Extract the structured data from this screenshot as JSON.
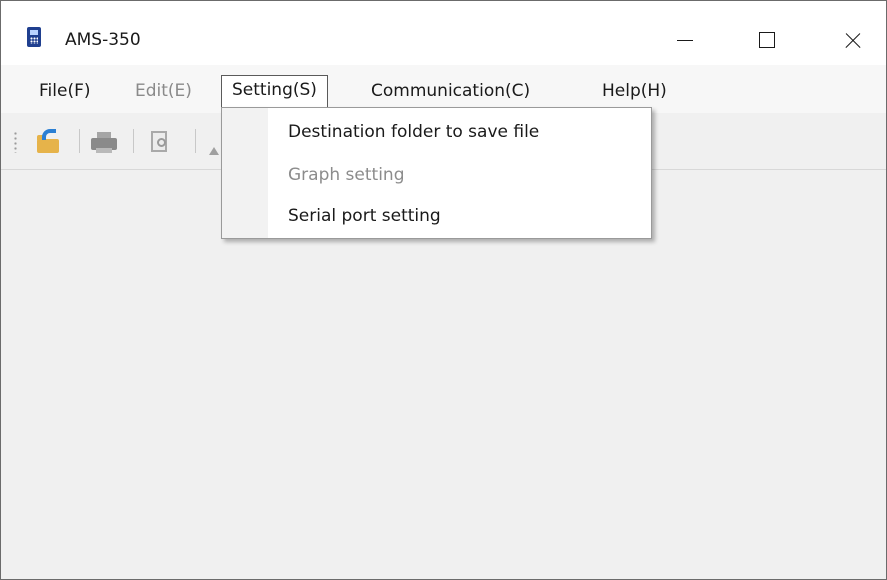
{
  "window": {
    "title": "AMS-350",
    "app_icon": "calculator-icon",
    "controls": {
      "minimize": "minimize-icon",
      "maximize": "maximize-icon",
      "close": "close-icon"
    }
  },
  "menubar": {
    "items": [
      {
        "label": "File(F)",
        "state": "normal"
      },
      {
        "label": "Edit(E)",
        "state": "disabled"
      },
      {
        "label": "Setting(S)",
        "state": "active"
      },
      {
        "label": "Communication(C)",
        "state": "normal"
      },
      {
        "label": "Help(H)",
        "state": "normal"
      }
    ]
  },
  "toolbar": {
    "buttons": [
      {
        "icon": "open-folder-icon",
        "enabled": true
      },
      {
        "icon": "print-icon",
        "enabled": false
      },
      {
        "icon": "print-preview-icon",
        "enabled": false
      },
      {
        "icon": "graph-icon",
        "enabled": false
      }
    ]
  },
  "dropdown": {
    "parent": "Setting(S)",
    "items": [
      {
        "label": "Destination folder to save file",
        "enabled": true
      },
      {
        "label": "Graph setting",
        "enabled": false
      },
      {
        "label": "Serial port setting",
        "enabled": true
      }
    ]
  },
  "colors": {
    "title_bar": "#ffffff",
    "client_area": "#f0f0f0",
    "menu_bar": "#f7f7f7",
    "disabled_text": "#8a8a8a",
    "folder": "#e6b34a",
    "arrow": "#2b7fd3"
  }
}
